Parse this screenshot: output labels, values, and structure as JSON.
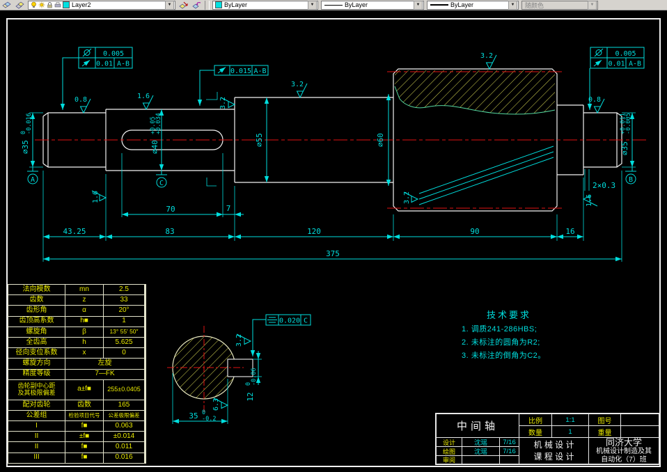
{
  "toolbar": {
    "layer": "Layer2",
    "color": "ByLayer",
    "linetype": "ByLayer",
    "lineweight": "ByLayer",
    "plot_style": "随颜色",
    "arrow": "▼"
  },
  "drawing": {
    "fcf1": {
      "v1": "0.005",
      "v2": "0.01",
      "datum": "A-B"
    },
    "fcf2": {
      "v": "0.015",
      "datum": "A-B"
    },
    "fcf3": {
      "v1": "0.005",
      "v2": "0.01",
      "datum": "A-B"
    },
    "symmetry": {
      "v": "0.020",
      "datum": "C"
    },
    "finish": {
      "f08": "0.8",
      "f16": "1.6",
      "f32": "3.2",
      "f63": "6.3"
    },
    "datums": {
      "a": "A",
      "b": "B",
      "c": "C"
    },
    "dia35_left": {
      "d": "⌀35",
      "up": "0",
      "low": "-0.016"
    },
    "dia40": {
      "d": "⌀40",
      "up": "+0.05",
      "low": "+0.034"
    },
    "dia55": "⌀55",
    "dia60": "⌀60",
    "dia35_right": {
      "d": "⌀35",
      "up": "+0.011",
      "low": "-0.005"
    },
    "chamfer": "2×0.3",
    "lengths": {
      "l1": "43.25",
      "l2": "83",
      "l3": "70",
      "l4": "7",
      "l5": "120",
      "l6": "90",
      "l7": "16",
      "total": "375"
    },
    "section": {
      "width": "35",
      "width_up": "0",
      "width_low": "-0.2",
      "key": "12",
      "key_up": "0",
      "key_low": "-0.06"
    }
  },
  "tech": {
    "title": "技术要求",
    "item1": "1. 调质241-286HBS;",
    "item2": "2. 未标注的圆角为R2;",
    "item3": "3. 未标注的倒角为C2。"
  },
  "gear_table": {
    "r1": {
      "l": "法向模数",
      "s": "mn",
      "v": "2.5"
    },
    "r2": {
      "l": "齿数",
      "s": "z",
      "v": "33"
    },
    "r3": {
      "l": "齿形角",
      "s": "α",
      "v": "20°"
    },
    "r4": {
      "l": "齿顶高系数",
      "s": "h■",
      "v": "1"
    },
    "r5": {
      "l": "螺旋角",
      "s": "β",
      "v": "13° 55′ 50″"
    },
    "r6": {
      "l": "全齿高",
      "s": "h",
      "v": "5.625"
    },
    "r7": {
      "l": "径向变位系数",
      "s": "x",
      "v": "0"
    },
    "r8": {
      "l": "螺旋方向",
      "v": "左旋"
    },
    "r9": {
      "l": "精度等级",
      "v": "7—FK"
    },
    "r10": {
      "l1": "齿轮副中心距",
      "l2": "及其极限偏差",
      "s": "a±f■",
      "v": "255±0.0405"
    },
    "r11": {
      "l": "配对齿轮",
      "s": "齿数",
      "v": "165"
    },
    "r12": {
      "l": "公差组",
      "s": "检验项目代号",
      "v": "公差极限偏差"
    },
    "r13": {
      "l": "I",
      "s": "f■",
      "v": "0.063"
    },
    "r14": {
      "l": "II",
      "s": "±f■",
      "v": "±0.014"
    },
    "r15": {
      "l": "II",
      "s": "f■",
      "v": "0.011"
    },
    "r16": {
      "l": "III",
      "s": "f■",
      "v": "0.016"
    }
  },
  "title_block": {
    "part_name": "中间轴",
    "scale_label": "比例",
    "scale_value": "1:1",
    "qty_label": "数量",
    "qty_value": "1",
    "drawing_no_label": "图号",
    "weight_label": "重量",
    "design_label": "设计",
    "design_name": "沈瑶",
    "design_date": "7/16",
    "draft_label": "绘图",
    "draft_name": "沈瑶",
    "draft_date": "7/16",
    "review_label": "审阅",
    "course_line1": "机 械 设 计",
    "course_line2": "课 程 设 计",
    "school": "同济大学",
    "class_line1": "机械设计制造及其",
    "class_line2": "自动化（7）班"
  }
}
